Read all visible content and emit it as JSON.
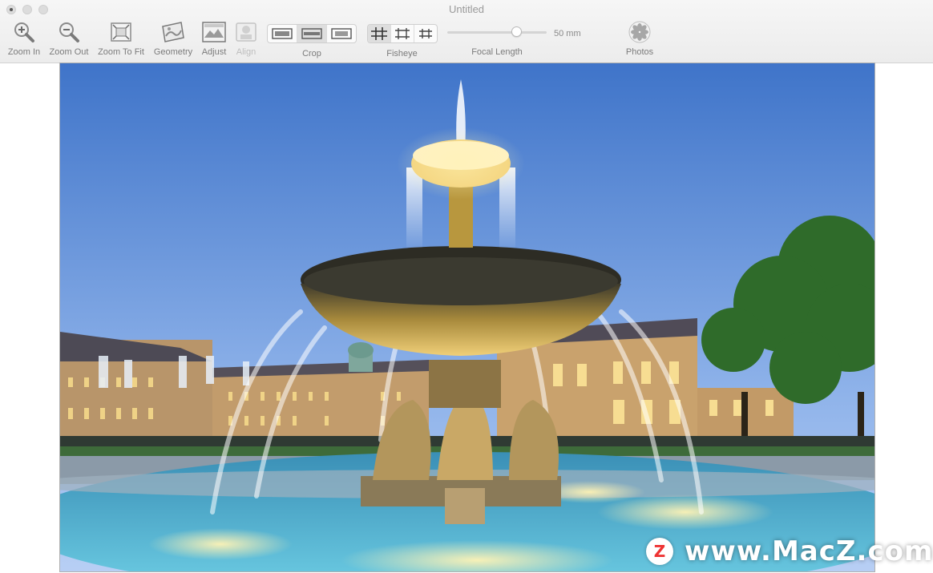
{
  "window": {
    "title": "Untitled"
  },
  "toolbar": {
    "zoom_in": {
      "label": "Zoom In",
      "icon": "zoom-in-icon"
    },
    "zoom_out": {
      "label": "Zoom Out",
      "icon": "zoom-out-icon"
    },
    "zoom_fit": {
      "label": "Zoom To Fit",
      "icon": "zoom-to-fit-icon"
    },
    "geometry": {
      "label": "Geometry",
      "icon": "geometry-icon"
    },
    "adjust": {
      "label": "Adjust",
      "icon": "adjust-icon"
    },
    "align": {
      "label": "Align",
      "icon": "align-icon",
      "disabled": true
    },
    "crop": {
      "label": "Crop",
      "options": [
        "crop-wide",
        "crop-medium",
        "crop-narrow"
      ],
      "selected_index": 1
    },
    "fisheye": {
      "label": "Fisheye",
      "options": [
        "grid-full",
        "grid-corner",
        "grid-center"
      ],
      "selected_index": 0
    },
    "focal_length": {
      "label": "Focal Length",
      "value": "50 mm",
      "position_fraction": 0.72
    },
    "photos": {
      "label": "Photos",
      "icon": "photos-icon"
    }
  },
  "watermark": {
    "logo_letter": "Z",
    "text": "www.MacZ.com"
  },
  "colors": {
    "sky_top": "#3f74c9",
    "sky_bottom": "#a9c7f3",
    "water": "#4fb6d6",
    "fountain_light": "#f3d27a",
    "tree": "#2f6b2a"
  }
}
